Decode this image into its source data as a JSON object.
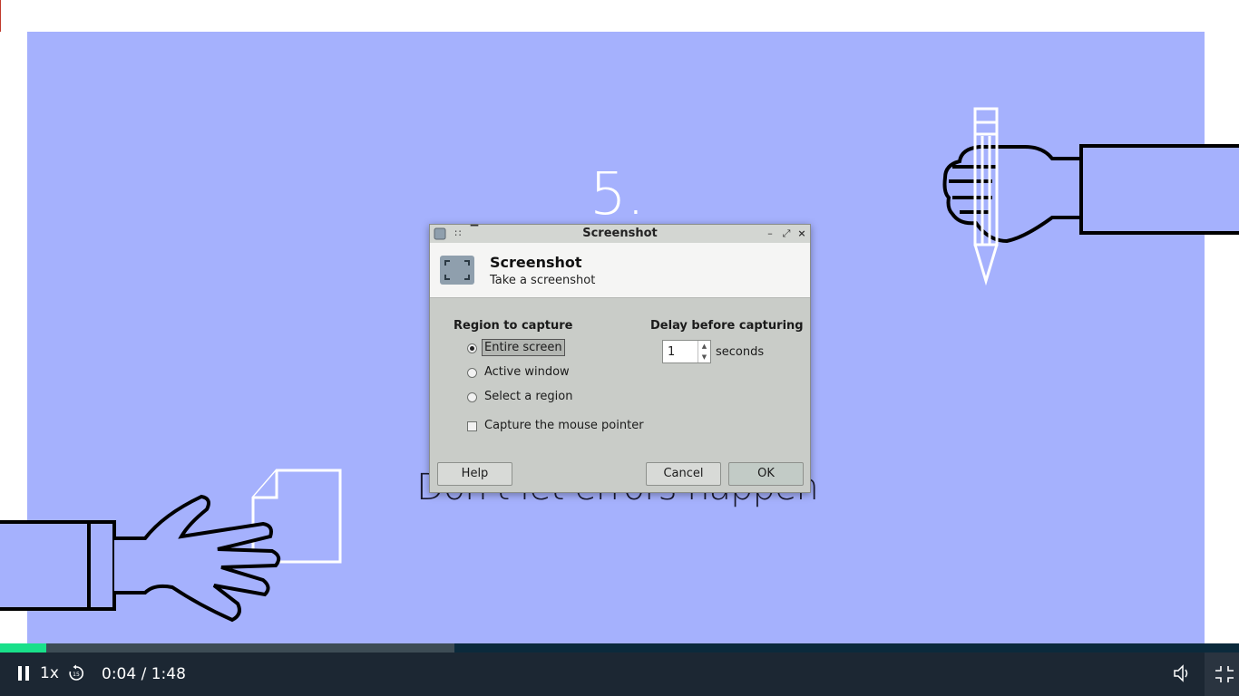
{
  "video": {
    "slide_number": "5.",
    "slide_caption": "Don't let errors happen",
    "background_color": "#a5b1fd"
  },
  "dialog": {
    "window_title": "Screenshot",
    "header_title": "Screenshot",
    "header_subtitle": "Take a screenshot",
    "region_label": "Region to capture",
    "options": [
      {
        "label": "Entire screen",
        "checked": true
      },
      {
        "label": "Active window",
        "checked": false
      },
      {
        "label": "Select a region",
        "checked": false
      }
    ],
    "capture_pointer_label": "Capture the mouse pointer",
    "capture_pointer_checked": false,
    "delay_label": "Delay before capturing",
    "delay_value": "1",
    "delay_unit": "seconds",
    "help_label": "Help",
    "cancel_label": "Cancel",
    "ok_label": "OK"
  },
  "player": {
    "speed": "1x",
    "time_current": "0:04",
    "time_separator": "/",
    "time_total": "1:48",
    "progress_fraction": 0.037,
    "buffered_fraction": 0.367,
    "progress_color": "#19e08a",
    "icons": [
      "pause-icon",
      "rewind-15-icon",
      "volume-icon",
      "exit-fullscreen-icon"
    ]
  }
}
